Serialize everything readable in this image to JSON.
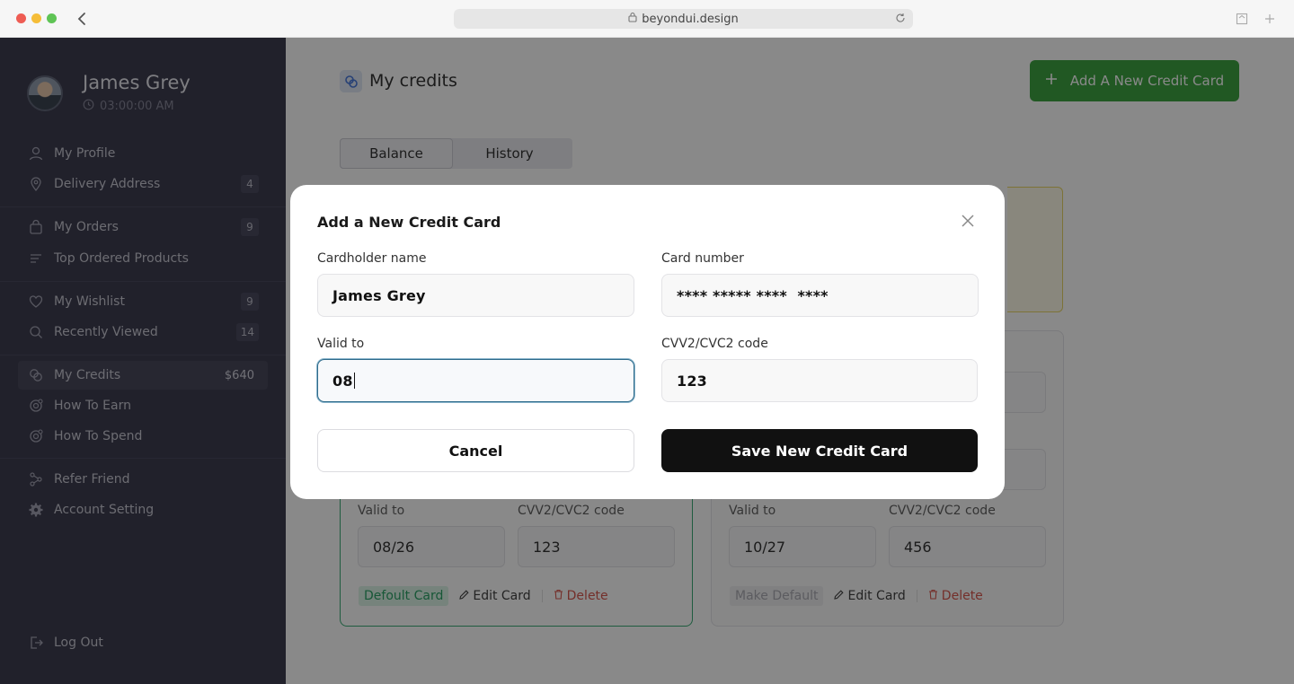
{
  "browser": {
    "url": "beyondui.design"
  },
  "sidebar": {
    "user_name": "James Grey",
    "user_time": "03:00:00 AM",
    "items": [
      {
        "label": "My Profile",
        "badge": ""
      },
      {
        "label": "Delivery Address",
        "badge": "4"
      },
      {
        "label": "My Orders",
        "badge": "9"
      },
      {
        "label": "Top Ordered Products",
        "badge": ""
      },
      {
        "label": "My Wishlist",
        "badge": "9"
      },
      {
        "label": "Recently Viewed",
        "badge": "14"
      },
      {
        "label": "My Credits",
        "badge": "$640"
      },
      {
        "label": "How To Earn",
        "badge": ""
      },
      {
        "label": "How To Spend",
        "badge": ""
      },
      {
        "label": "Refer Friend",
        "badge": ""
      },
      {
        "label": "Account Setting",
        "badge": ""
      },
      {
        "label": "Log Out",
        "badge": ""
      }
    ]
  },
  "main": {
    "title": "My credits",
    "add_button": "Add A New Credit Card",
    "tabs": [
      "Balance",
      "History"
    ],
    "cards": [
      {
        "valid_label": "Valid to",
        "valid": "08/26",
        "cvv_label": "CVV2/CVC2 code",
        "cvv": "123",
        "default_label": "Defoult Card",
        "edit": "Edit Card",
        "delete": "Delete"
      },
      {
        "valid_label": "Valid to",
        "valid": "10/27",
        "cvv_label": "CVV2/CVC2 code",
        "cvv": "456",
        "default_label": "Make Default",
        "edit": "Edit Card",
        "delete": "Delete"
      }
    ]
  },
  "modal": {
    "title": "Add a New Credit Card",
    "cardholder_label": "Cardholder name",
    "cardholder_value": "James Grey",
    "number_label": "Card number",
    "number_value": "**** ***** ****  ****",
    "valid_label": "Valid to",
    "valid_value": "08",
    "cvv_label": "CVV2/CVC2 code",
    "cvv_value": "123",
    "cancel": "Cancel",
    "save": "Save New Credit Card"
  }
}
